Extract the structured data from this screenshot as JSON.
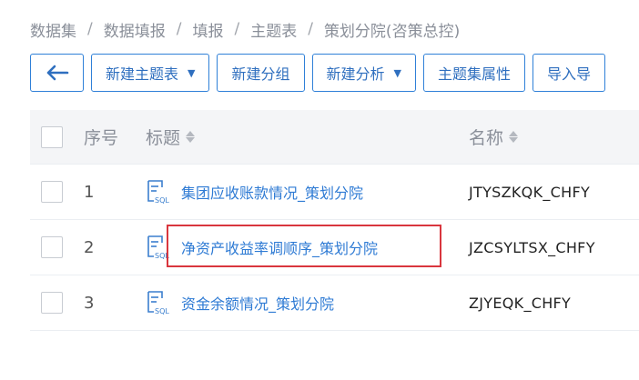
{
  "breadcrumb": [
    "数据集",
    "数据填报",
    "填报",
    "主题表",
    "策划分院(咨策总控)"
  ],
  "toolbar": {
    "back_icon": "arrow-left-icon",
    "new_subject_table": "新建主题表",
    "new_group": "新建分组",
    "new_analysis": "新建分析",
    "subject_set_props": "主题集属性",
    "import": "导入导"
  },
  "table": {
    "headers": {
      "seq": "序号",
      "title": "标题",
      "name": "名称"
    },
    "rows": [
      {
        "seq": "1",
        "title": "集团应收账款情况_策划分院",
        "name": "JTYSZKQK_CHFY"
      },
      {
        "seq": "2",
        "title": "净资产收益率调顺序_策划分院",
        "name": "JZCSYLTSX_CHFY"
      },
      {
        "seq": "3",
        "title": "资金余额情况_策划分院",
        "name": "ZJYEQK_CHFY"
      }
    ]
  },
  "colors": {
    "accent": "#2f80d8",
    "link": "#2f7bd4",
    "highlight": "#d9363e"
  }
}
